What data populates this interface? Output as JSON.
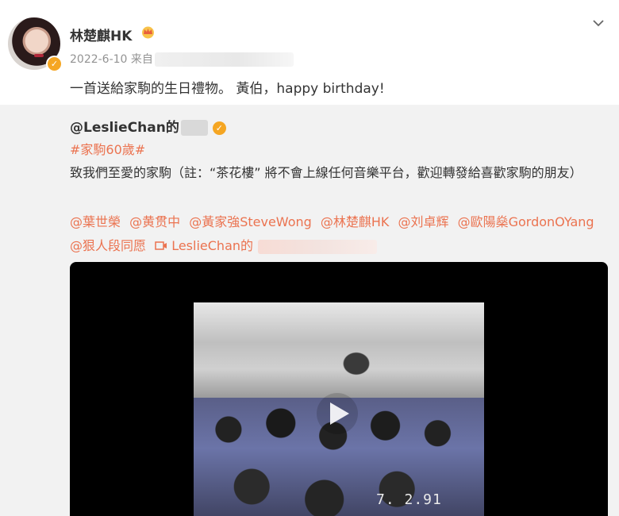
{
  "post": {
    "author_name": "林楚麒HK",
    "date": "2022-6-10",
    "source_prefix": "来自",
    "text": "一首送給家駒的生日禮物。 黃伯，happy birthday!"
  },
  "repost": {
    "author_name": "@LeslieChan的",
    "hashtag": "#家駒60歲#",
    "body": "致我們至愛的家駒（註：“茶花樓” 將不會上線任何音樂平台，歡迎轉發給喜歡家駒的朋友）",
    "mentions": [
      "@葉世榮",
      "@黄贯中",
      "@黃家強SteveWong",
      "@林楚麒HK",
      "@刘卓辉",
      "@歐陽燊GordonOYang",
      "@狠人段同愿"
    ],
    "video_link_label": "LeslieChan的"
  },
  "video": {
    "timestamp": "7. 2.91"
  },
  "colors": {
    "link": "#eb7350",
    "verified": "#f5a623",
    "repost_bg": "#f2f2f2"
  },
  "icons": [
    "verified-badge-icon",
    "crown-icon",
    "chevron-down-icon",
    "play-icon",
    "video-link-icon"
  ]
}
